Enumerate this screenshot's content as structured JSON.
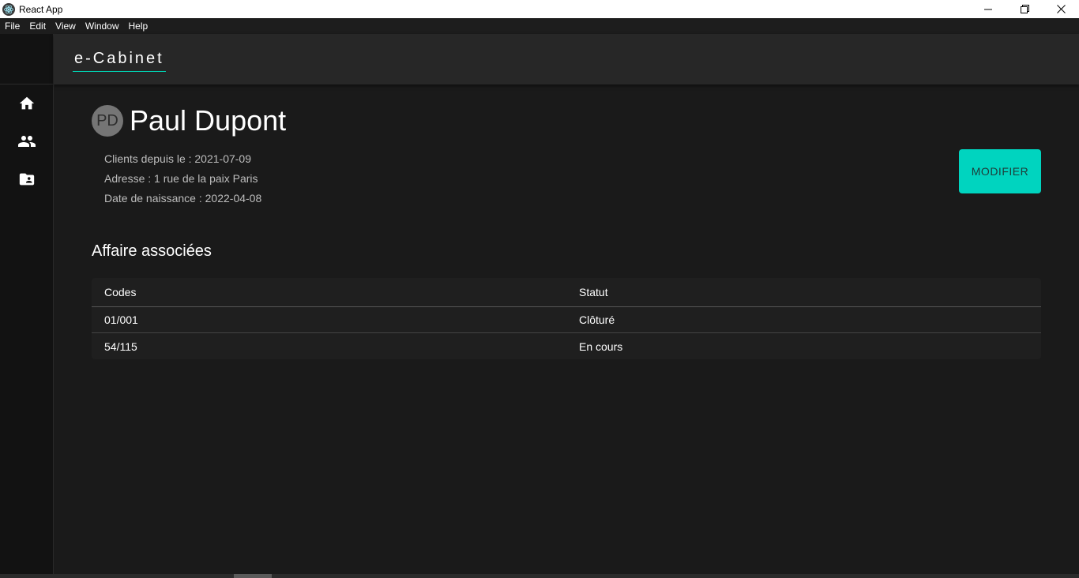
{
  "window": {
    "title": "React App",
    "controls": [
      "minimize-icon",
      "restore-icon",
      "close-icon"
    ]
  },
  "menubar": {
    "items": [
      "File",
      "Edit",
      "View",
      "Window",
      "Help"
    ]
  },
  "sidebar": {
    "items": [
      {
        "icon": "home-icon"
      },
      {
        "icon": "people-icon"
      },
      {
        "icon": "contact-folder-icon"
      }
    ]
  },
  "header": {
    "brand": "e-Cabinet"
  },
  "profile": {
    "initials": "PD",
    "name": "Paul Dupont",
    "client_since": "Clients depuis le : 2021-07-09",
    "address": "Adresse : 1 rue de la paix Paris",
    "birth_date": "Date de naissance : 2022-04-08",
    "modify_label": "MODIFIER"
  },
  "cases": {
    "title": "Affaire associées",
    "columns": [
      "Codes",
      "Statut"
    ],
    "rows": [
      {
        "code": "01/001",
        "status": "Clôturé"
      },
      {
        "code": "54/115",
        "status": "En cours"
      }
    ]
  },
  "colors": {
    "accent": "#00d4bf",
    "background": "#1a1a1a",
    "sidebar": "#121212",
    "header": "#272727"
  }
}
